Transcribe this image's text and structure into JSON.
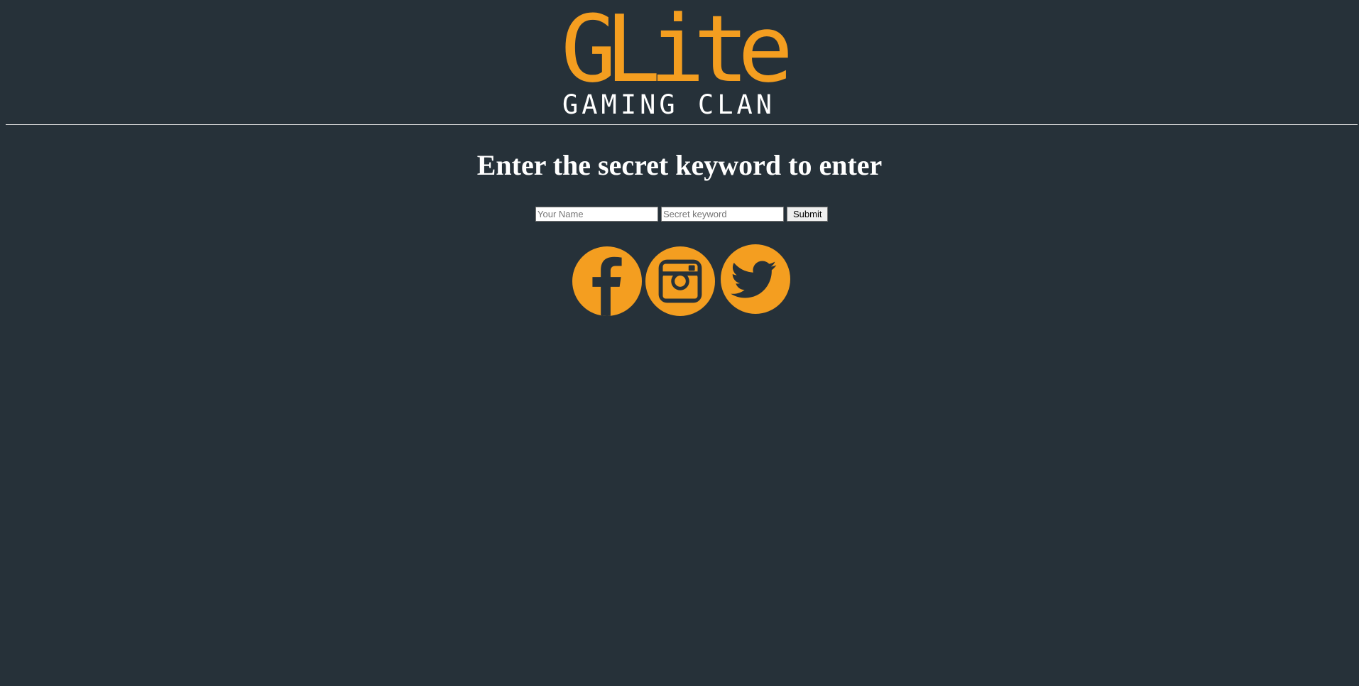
{
  "logo": {
    "wordmark": "GLite",
    "tagline": "GAMING CLAN",
    "accent_color": "#f49e20"
  },
  "colors": {
    "background": "#263139",
    "text": "#ffffff",
    "icon": "#f49e20"
  },
  "heading": "Enter the secret keyword to enter",
  "form": {
    "name_placeholder": "Your Name",
    "name_value": "",
    "keyword_placeholder": "Secret keyword",
    "keyword_value": "",
    "submit_label": "Submit"
  },
  "social": {
    "icons": [
      "facebook-icon",
      "instagram-icon",
      "twitter-icon"
    ]
  }
}
